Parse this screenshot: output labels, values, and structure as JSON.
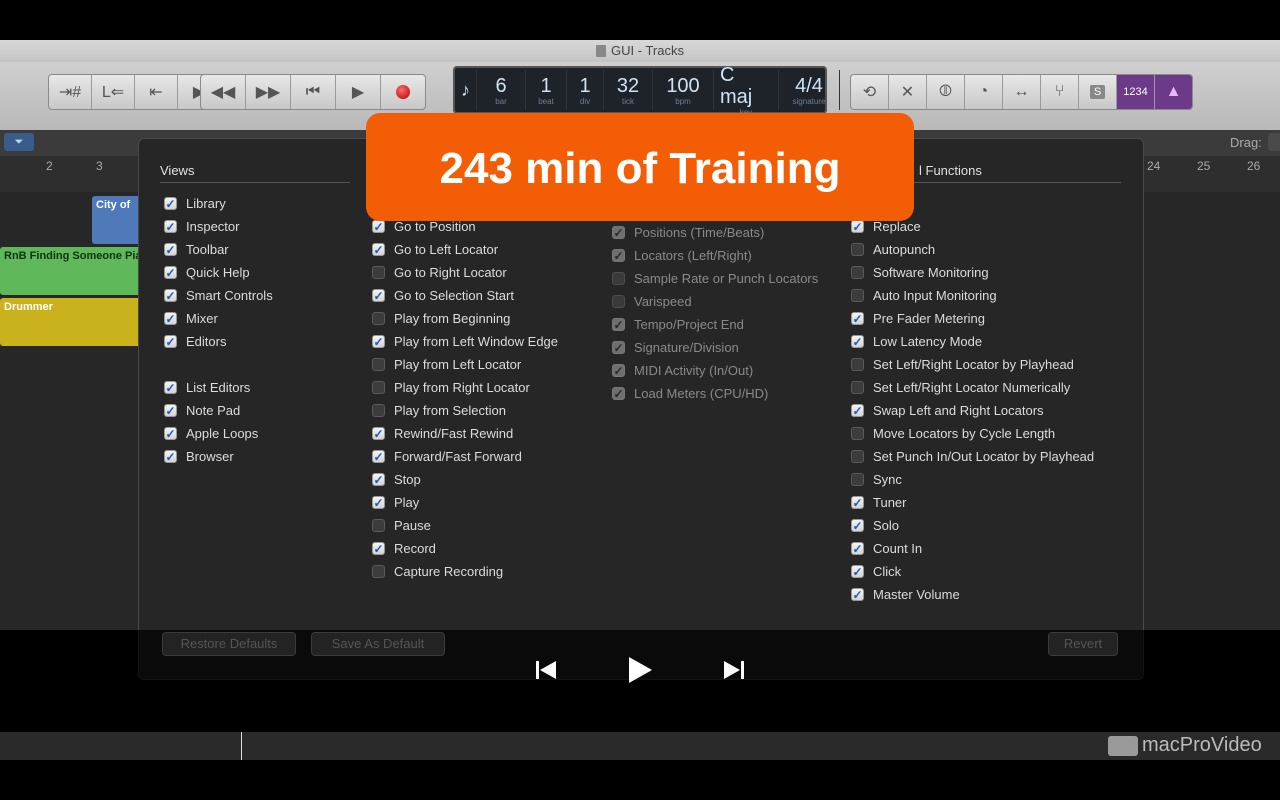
{
  "window": {
    "title": "GUI - Tracks"
  },
  "lcd": [
    {
      "value": "6",
      "label": "bar"
    },
    {
      "value": "1",
      "label": "beat"
    },
    {
      "value": "1",
      "label": "div"
    },
    {
      "value": "32",
      "label": "tick"
    },
    {
      "value": "100",
      "label": "bpm"
    },
    {
      "value": "C maj",
      "label": "key"
    },
    {
      "value": "4/4",
      "label": "signature"
    }
  ],
  "toolbar_right": {
    "solo_label": "S",
    "count_in_label": "1234"
  },
  "tracks_header": {
    "drag_label": "Drag:"
  },
  "ruler": {
    "ticks": [
      "2",
      "3",
      "24",
      "25",
      "26"
    ]
  },
  "regions": {
    "city": "City of",
    "rnb": "RnB Finding Someone Pia",
    "drummer": "Drummer"
  },
  "dialog": {
    "views_header": "Views",
    "functions_header": "l Functions",
    "views": [
      {
        "label": "Library",
        "checked": true
      },
      {
        "label": "Inspector",
        "checked": true
      },
      {
        "label": "Toolbar",
        "checked": true
      },
      {
        "label": "Quick Help",
        "checked": true
      },
      {
        "label": "Smart Controls",
        "checked": true
      },
      {
        "label": "Mixer",
        "checked": true
      },
      {
        "label": "Editors",
        "checked": true
      },
      {
        "label": "List Editors",
        "checked": true
      },
      {
        "label": "Note Pad",
        "checked": true
      },
      {
        "label": "Apple Loops",
        "checked": true
      },
      {
        "label": "Browser",
        "checked": true
      }
    ],
    "transport": [
      {
        "label": "Go to Position",
        "checked": true
      },
      {
        "label": "Go to Left Locator",
        "checked": true
      },
      {
        "label": "Go to Right Locator",
        "checked": false
      },
      {
        "label": "Go to Selection Start",
        "checked": true
      },
      {
        "label": "Play from Beginning",
        "checked": false
      },
      {
        "label": "Play from Left Window Edge",
        "checked": true
      },
      {
        "label": "Play from Left Locator",
        "checked": false
      },
      {
        "label": "Play from Right Locator",
        "checked": false
      },
      {
        "label": "Play from Selection",
        "checked": false
      },
      {
        "label": "Rewind/Fast Rewind",
        "checked": true
      },
      {
        "label": "Forward/Fast Forward",
        "checked": true
      },
      {
        "label": "Stop",
        "checked": true
      },
      {
        "label": "Play",
        "checked": true
      },
      {
        "label": "Pause",
        "checked": false
      },
      {
        "label": "Record",
        "checked": true
      },
      {
        "label": "Capture Recording",
        "checked": false
      }
    ],
    "display": [
      {
        "label": "Positions (Time/Beats)",
        "checked": true
      },
      {
        "label": "Locators (Left/Right)",
        "checked": true
      },
      {
        "label": "Sample Rate or Punch Locators",
        "checked": false
      },
      {
        "label": "Varispeed",
        "checked": false
      },
      {
        "label": "Tempo/Project End",
        "checked": true
      },
      {
        "label": "Signature/Division",
        "checked": true
      },
      {
        "label": "MIDI Activity (In/Out)",
        "checked": true
      },
      {
        "label": "Load Meters (CPU/HD)",
        "checked": true
      }
    ],
    "functions": [
      {
        "label": "Replace",
        "checked": true
      },
      {
        "label": "Autopunch",
        "checked": false
      },
      {
        "label": "Software Monitoring",
        "checked": false
      },
      {
        "label": "Auto Input Monitoring",
        "checked": false
      },
      {
        "label": "Pre Fader Metering",
        "checked": true
      },
      {
        "label": "Low Latency Mode",
        "checked": true
      },
      {
        "label": "Set Left/Right Locator by Playhead",
        "checked": false
      },
      {
        "label": "Set Left/Right Locator Numerically",
        "checked": false
      },
      {
        "label": "Swap Left and Right Locators",
        "checked": true
      },
      {
        "label": "Move Locators by Cycle Length",
        "checked": false
      },
      {
        "label": "Set Punch In/Out Locator by Playhead",
        "checked": false
      },
      {
        "label": "Sync",
        "checked": false
      },
      {
        "label": "Tuner",
        "checked": true
      },
      {
        "label": "Solo",
        "checked": true
      },
      {
        "label": "Count In",
        "checked": true
      },
      {
        "label": "Click",
        "checked": true
      },
      {
        "label": "Master Volume",
        "checked": true
      }
    ],
    "buttons": {
      "restore": "Restore Defaults",
      "save": "Save As Default",
      "revert": "Revert"
    }
  },
  "banner": {
    "text": "243 min of Training"
  },
  "brand": {
    "text": "macProVideo"
  },
  "colors": {
    "banner": "#f25d05",
    "checkbox_check": "#1e5bb8",
    "region_blue": "#4f79b8",
    "region_green": "#5fb85a",
    "region_yellow": "#c9b21c"
  }
}
